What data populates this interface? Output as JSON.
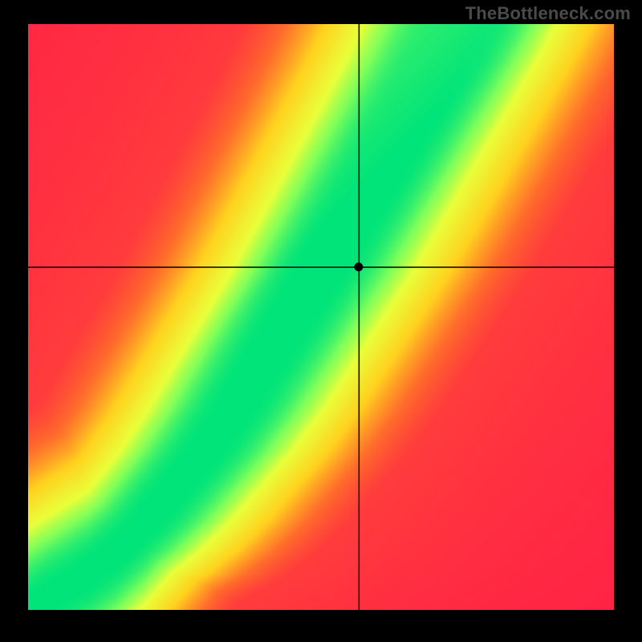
{
  "watermark": "TheBottleneck.com",
  "chart_data": {
    "type": "heatmap",
    "title": "",
    "xlabel": "",
    "ylabel": "",
    "xlim": [
      0,
      1
    ],
    "ylim": [
      0,
      1
    ],
    "crosshair": {
      "x": 0.565,
      "y": 0.585
    },
    "marker": {
      "x": 0.565,
      "y": 0.585
    },
    "optimal_curve": [
      {
        "x": 0.0,
        "y": 0.0
      },
      {
        "x": 0.05,
        "y": 0.03
      },
      {
        "x": 0.1,
        "y": 0.06
      },
      {
        "x": 0.15,
        "y": 0.1
      },
      {
        "x": 0.2,
        "y": 0.15
      },
      {
        "x": 0.25,
        "y": 0.21
      },
      {
        "x": 0.3,
        "y": 0.27
      },
      {
        "x": 0.35,
        "y": 0.34
      },
      {
        "x": 0.4,
        "y": 0.42
      },
      {
        "x": 0.45,
        "y": 0.5
      },
      {
        "x": 0.5,
        "y": 0.58
      },
      {
        "x": 0.55,
        "y": 0.67
      },
      {
        "x": 0.6,
        "y": 0.76
      },
      {
        "x": 0.65,
        "y": 0.85
      },
      {
        "x": 0.7,
        "y": 0.94
      },
      {
        "x": 0.73,
        "y": 1.0
      }
    ],
    "colorscale": [
      {
        "t": 0.0,
        "color": "#ff1f47"
      },
      {
        "t": 0.25,
        "color": "#ff6a2c"
      },
      {
        "t": 0.5,
        "color": "#ffd21f"
      },
      {
        "t": 0.75,
        "color": "#e9ff3a"
      },
      {
        "t": 0.88,
        "color": "#7fff5a"
      },
      {
        "t": 1.0,
        "color": "#00e47a"
      }
    ],
    "green_halfwidth": 0.035,
    "falloff": 2.2
  }
}
